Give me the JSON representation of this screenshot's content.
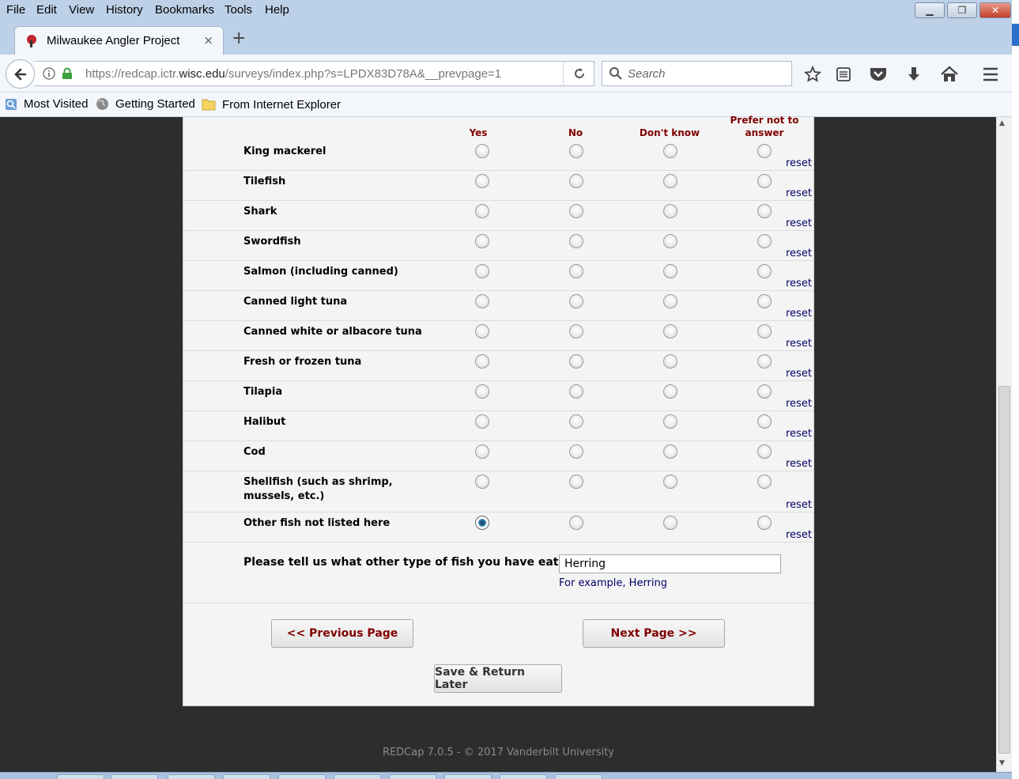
{
  "menu": [
    "File",
    "Edit",
    "View",
    "History",
    "Bookmarks",
    "Tools",
    "Help"
  ],
  "tab": {
    "title": "Milwaukee Angler Project",
    "close": "×",
    "new_tab": "+"
  },
  "url": {
    "prefix": "https://redcap.ictr.",
    "domain": "wisc.edu",
    "suffix": "/surveys/index.php?s=LPDX83D78A&__prevpage=1"
  },
  "search": {
    "placeholder": "Search"
  },
  "bookmarks": [
    "Most Visited",
    "Getting Started",
    "From Internet Explorer"
  ],
  "columns": [
    "Yes",
    "No",
    "Don't know",
    "Prefer not to answer"
  ],
  "reset_label": "reset",
  "fish": [
    {
      "label": "King mackerel",
      "selected": -1
    },
    {
      "label": "Tilefish",
      "selected": -1
    },
    {
      "label": "Shark",
      "selected": -1
    },
    {
      "label": "Swordfish",
      "selected": -1
    },
    {
      "label": "Salmon (including canned)",
      "selected": -1
    },
    {
      "label": "Canned light tuna",
      "selected": -1
    },
    {
      "label": "Canned white or albacore tuna",
      "selected": -1
    },
    {
      "label": "Fresh or frozen tuna",
      "selected": -1
    },
    {
      "label": "Tilapia",
      "selected": -1
    },
    {
      "label": "Halibut",
      "selected": -1
    },
    {
      "label": "Cod",
      "selected": -1
    },
    {
      "label": "Shellfish (such as shrimp, mussels, etc.)",
      "selected": -1
    },
    {
      "label": "Other fish not listed here",
      "selected": 0
    }
  ],
  "other": {
    "question": "Please tell us what other type of fish you have eaten.",
    "value": "Herring",
    "hint": "For example, Herring"
  },
  "buttons": {
    "prev": "<< Previous Page",
    "next": "Next Page >>",
    "save": "Save & Return Later"
  },
  "footer": "REDCap 7.0.5 - © 2017 Vanderbilt University"
}
